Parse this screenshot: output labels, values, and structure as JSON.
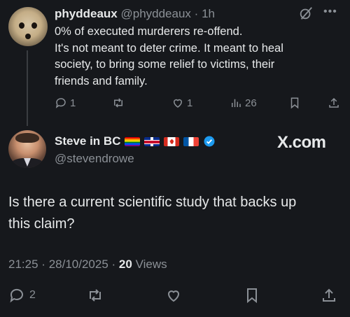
{
  "parent_tweet": {
    "display_name": "phyddeaux",
    "handle": "@phyddeaux",
    "separator": "·",
    "time": "1h",
    "more_icon": "more-icon",
    "text_lines": [
      "0% of executed murderers re-offend.",
      "It's not meant to deter crime. It meant to heal",
      "society, to bring some relief to victims, their",
      "friends and family."
    ],
    "actions": {
      "replies": "1",
      "reposts": "",
      "likes": "1",
      "views": "26"
    }
  },
  "reply_tweet": {
    "display_name": "Steve in BC",
    "handle": "@stevendrowe",
    "flags": [
      "rainbow-flag",
      "uk-flag",
      "canada-flag",
      "france-flag"
    ],
    "verified_icon": "verified-badge-icon",
    "watermark": "X.com",
    "text_lines": [
      "Is there a current scientific study that backs up",
      "this claim?"
    ],
    "meta": {
      "time": "21:25",
      "date": "28/10/2025",
      "separator": "·",
      "views_count": "20",
      "views_label": "Views"
    },
    "actions": {
      "replies": "2",
      "reposts": "",
      "likes": "",
      "bookmarks": ""
    }
  },
  "colors": {
    "background": "#16181c",
    "text_primary": "#e7e9ea",
    "text_secondary": "#8b9096",
    "verified_blue": "#1d9bf0"
  }
}
